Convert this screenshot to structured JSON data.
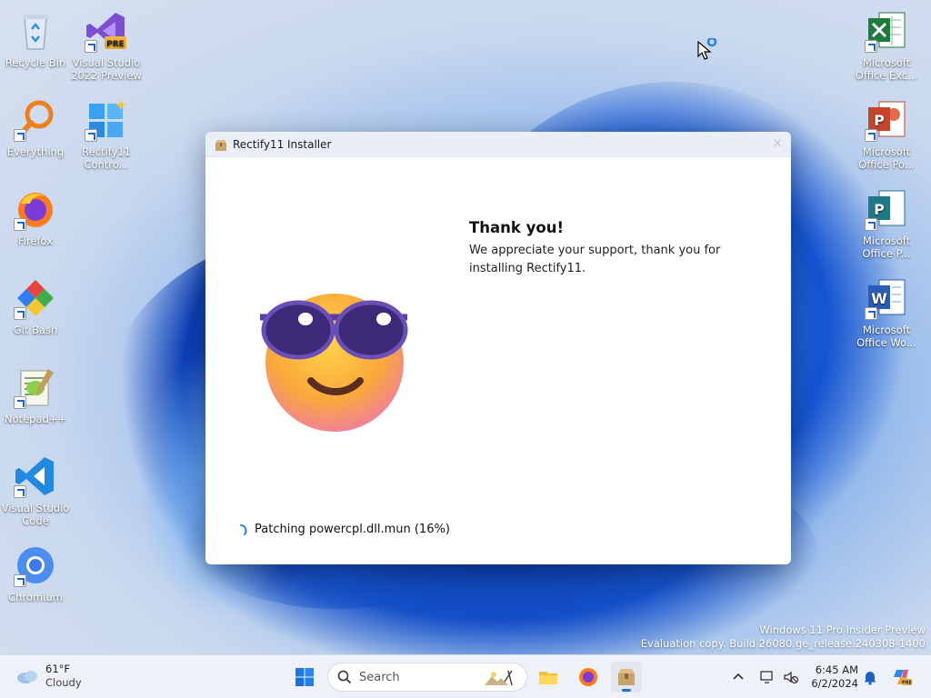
{
  "desktop": {
    "left_icons": [
      {
        "label": "Recycle Bin",
        "icon": "recycle-bin-icon"
      },
      {
        "label": "Visual Studio 2022 Preview",
        "icon": "visual-studio-preview-icon",
        "badge": "PRE"
      },
      {
        "label": "Everything",
        "icon": "everything-search-icon"
      },
      {
        "label": "Rectify11 Contro...",
        "icon": "rectify11-control-icon"
      },
      {
        "label": "Firefox",
        "icon": "firefox-icon"
      },
      {
        "label": "Git Bash",
        "icon": "git-bash-icon"
      },
      {
        "label": "Notepad++",
        "icon": "notepadpp-icon"
      },
      {
        "label": "Visual Studio Code",
        "icon": "vscode-icon"
      },
      {
        "label": "Chromium",
        "icon": "chromium-icon"
      }
    ],
    "right_icons": [
      {
        "label": "Microsoft Office Exc...",
        "icon": "excel-icon"
      },
      {
        "label": "Microsoft Office Po...",
        "icon": "powerpoint-icon"
      },
      {
        "label": "Microsoft Office P...",
        "icon": "publisher-icon"
      },
      {
        "label": "Microsoft Office Wo...",
        "icon": "word-icon"
      }
    ]
  },
  "installer": {
    "title": "Rectify11 Installer",
    "heading": "Thank you!",
    "message": "We appreciate your support, thank you for installing Rectify11.",
    "status": "Patching powercpl.dll.mun (16%)"
  },
  "watermark": {
    "line1": "Windows 11 Pro Insider Preview",
    "line2": "Evaluation copy. Build 26080.ge_release.240308-1400"
  },
  "taskbar": {
    "weather_temp": "61°F",
    "weather_cond": "Cloudy",
    "search_placeholder": "Search",
    "time": "6:45 AM",
    "date": "6/2/2024"
  },
  "colors": {
    "accent": "#1f6fd8",
    "window_bg": "#ffffff",
    "taskbar_bg": "#eef1f7"
  }
}
